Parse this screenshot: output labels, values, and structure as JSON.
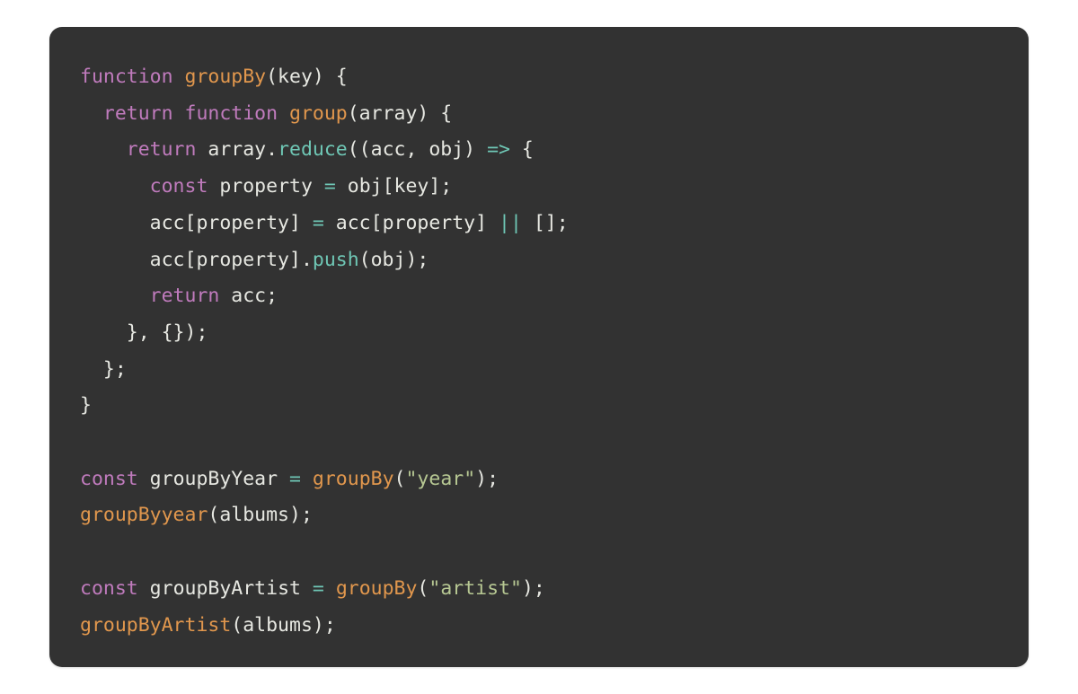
{
  "code": {
    "syntax_theme": {
      "background": "#323232",
      "default_text": "#e7e8e2",
      "keyword": "#c07bbd",
      "function_name": "#e1974d",
      "method_name": "#6fc7b5",
      "operator": "#6fc7b5",
      "string": "#b7c893"
    },
    "language": "javascript",
    "tokens": [
      [
        {
          "t": "function ",
          "c": "kw"
        },
        {
          "t": "groupBy",
          "c": "fn"
        },
        {
          "t": "(key) {",
          "c": "pn"
        }
      ],
      [
        {
          "t": "  ",
          "c": "pn"
        },
        {
          "t": "return ",
          "c": "kw"
        },
        {
          "t": "function ",
          "c": "kw"
        },
        {
          "t": "group",
          "c": "fn"
        },
        {
          "t": "(array) {",
          "c": "pn"
        }
      ],
      [
        {
          "t": "    ",
          "c": "pn"
        },
        {
          "t": "return",
          "c": "kw"
        },
        {
          "t": " array.",
          "c": "pn"
        },
        {
          "t": "reduce",
          "c": "mth"
        },
        {
          "t": "((acc, obj) ",
          "c": "pn"
        },
        {
          "t": "=>",
          "c": "op"
        },
        {
          "t": " {",
          "c": "pn"
        }
      ],
      [
        {
          "t": "      ",
          "c": "pn"
        },
        {
          "t": "const",
          "c": "kw"
        },
        {
          "t": " property ",
          "c": "pn"
        },
        {
          "t": "=",
          "c": "op"
        },
        {
          "t": " obj[key];",
          "c": "pn"
        }
      ],
      [
        {
          "t": "      acc[property] ",
          "c": "pn"
        },
        {
          "t": "=",
          "c": "op"
        },
        {
          "t": " acc[property] ",
          "c": "pn"
        },
        {
          "t": "||",
          "c": "op"
        },
        {
          "t": " [];",
          "c": "pn"
        }
      ],
      [
        {
          "t": "      acc[property].",
          "c": "pn"
        },
        {
          "t": "push",
          "c": "mth"
        },
        {
          "t": "(obj);",
          "c": "pn"
        }
      ],
      [
        {
          "t": "      ",
          "c": "pn"
        },
        {
          "t": "return",
          "c": "kw"
        },
        {
          "t": " acc;",
          "c": "pn"
        }
      ],
      [
        {
          "t": "    }, {});",
          "c": "pn"
        }
      ],
      [
        {
          "t": "  };",
          "c": "pn"
        }
      ],
      [
        {
          "t": "}",
          "c": "pn"
        }
      ],
      [],
      [
        {
          "t": "const",
          "c": "kw"
        },
        {
          "t": " groupByYear ",
          "c": "pn"
        },
        {
          "t": "=",
          "c": "op"
        },
        {
          "t": " ",
          "c": "pn"
        },
        {
          "t": "groupBy",
          "c": "fn"
        },
        {
          "t": "(",
          "c": "pn"
        },
        {
          "t": "\"year\"",
          "c": "str"
        },
        {
          "t": ");",
          "c": "pn"
        }
      ],
      [
        {
          "t": "groupByyear",
          "c": "fn"
        },
        {
          "t": "(albums);",
          "c": "pn"
        }
      ],
      [],
      [
        {
          "t": "const",
          "c": "kw"
        },
        {
          "t": " groupByArtist ",
          "c": "pn"
        },
        {
          "t": "=",
          "c": "op"
        },
        {
          "t": " ",
          "c": "pn"
        },
        {
          "t": "groupBy",
          "c": "fn"
        },
        {
          "t": "(",
          "c": "pn"
        },
        {
          "t": "\"artist\"",
          "c": "str"
        },
        {
          "t": ");",
          "c": "pn"
        }
      ],
      [
        {
          "t": "groupByArtist",
          "c": "fn"
        },
        {
          "t": "(albums);",
          "c": "pn"
        }
      ]
    ]
  }
}
